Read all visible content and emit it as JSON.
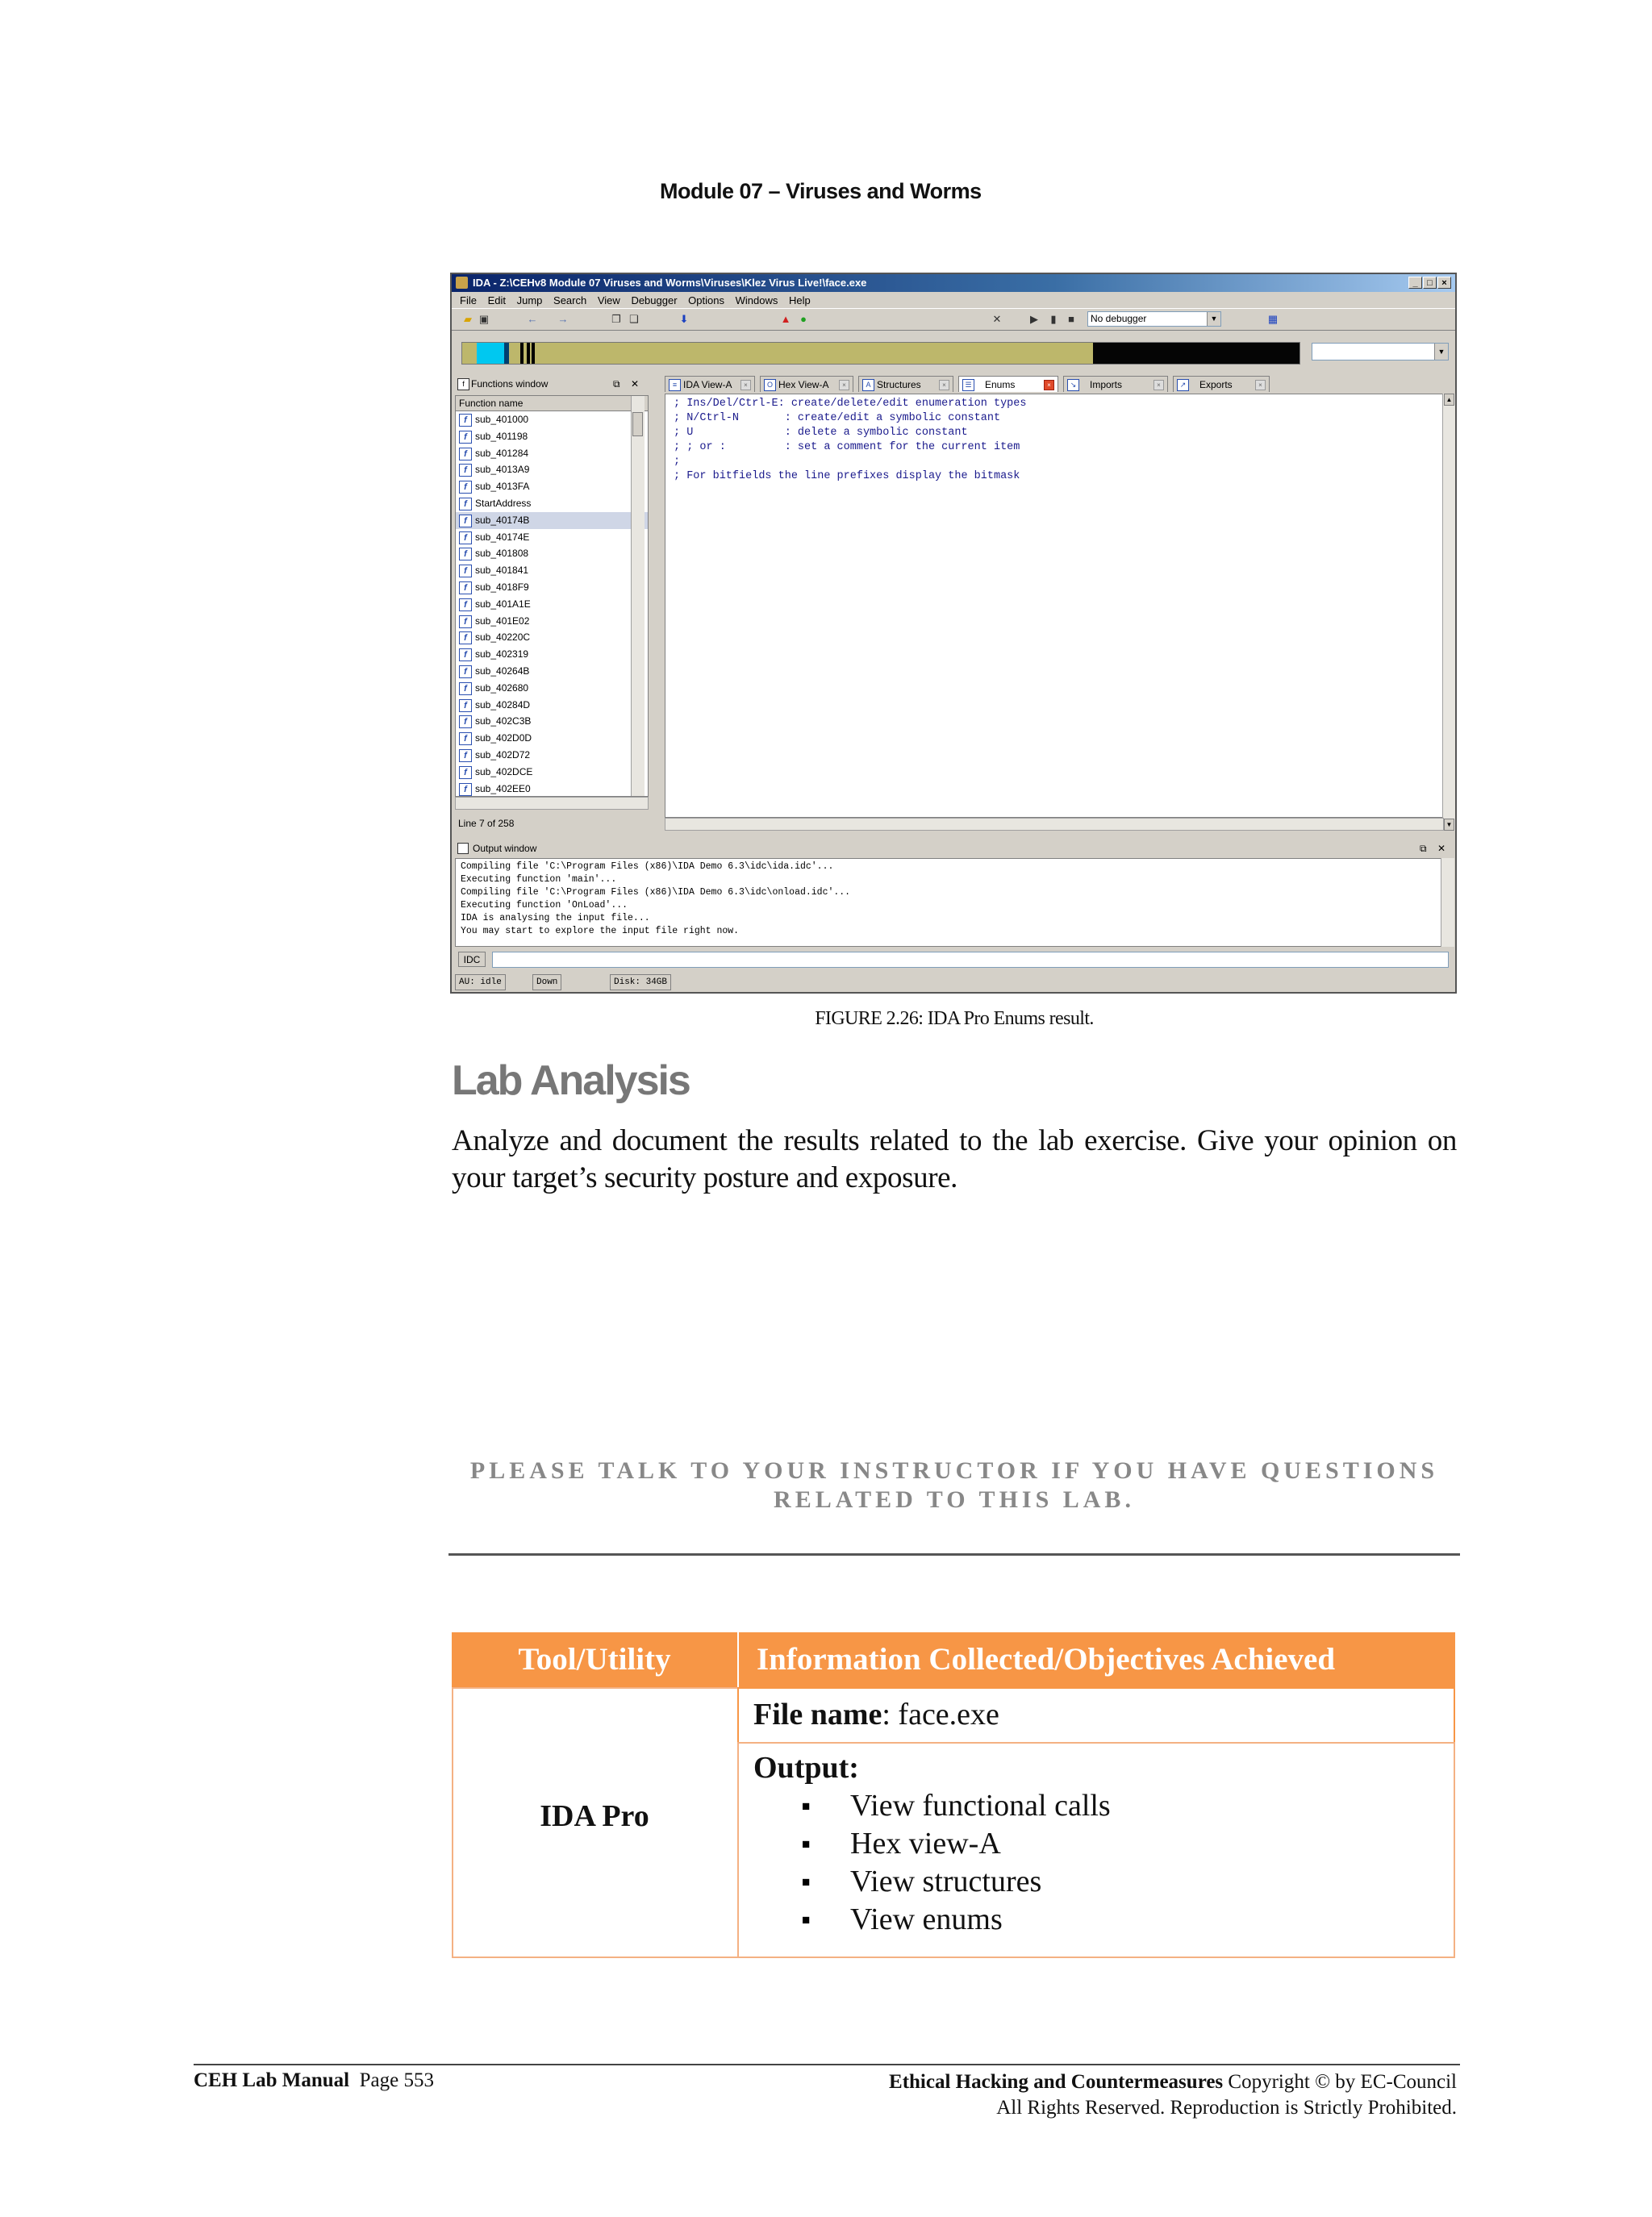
{
  "header": {
    "module_title": "Module 07 – Viruses and Worms"
  },
  "ida": {
    "title": "IDA - Z:\\CEHv8 Module 07 Viruses and Worms\\Viruses\\Klez Virus Live!\\face.exe",
    "menu": [
      "File",
      "Edit",
      "Jump",
      "Search",
      "View",
      "Debugger",
      "Options",
      "Windows",
      "Help"
    ],
    "debugger_select": "No debugger",
    "functions_pane": {
      "title": "Functions window",
      "column_header": "Function name",
      "functions": [
        "sub_401000",
        "sub_401198",
        "sub_401284",
        "sub_4013A9",
        "sub_4013FA",
        "StartAddress",
        "sub_40174B",
        "sub_40174E",
        "sub_401808",
        "sub_401841",
        "sub_4018F9",
        "sub_401A1E",
        "sub_401E02",
        "sub_40220C",
        "sub_402319",
        "sub_40264B",
        "sub_402680",
        "sub_40284D",
        "sub_402C3B",
        "sub_402D0D",
        "sub_402D72",
        "sub_402DCE",
        "sub_402EE0"
      ],
      "selected_index": 6,
      "status": "Line 7 of 258"
    },
    "tabs": [
      {
        "label": "IDA View-A",
        "icon": "ida-view-icon"
      },
      {
        "label": "Hex View-A",
        "icon": "hex-view-icon"
      },
      {
        "label": "Structures",
        "icon": "structures-icon"
      },
      {
        "label": "Enums",
        "icon": "enums-icon"
      },
      {
        "label": "Imports",
        "icon": "imports-icon"
      },
      {
        "label": "Exports",
        "icon": "exports-icon"
      }
    ],
    "active_tab": "Enums",
    "enums_lines": [
      "; Ins/Del/Ctrl-E: create/delete/edit enumeration types",
      "; N/Ctrl-N       : create/edit a symbolic constant",
      "; U              : delete a symbolic constant",
      "; ; or :         : set a comment for the current item",
      ";",
      "; For bitfields the line prefixes display the bitmask"
    ],
    "output_title": "Output window",
    "output_lines": [
      "Compiling file 'C:\\Program Files (x86)\\IDA Demo 6.3\\idc\\ida.idc'...",
      "Executing function 'main'...",
      "Compiling file 'C:\\Program Files (x86)\\IDA Demo 6.3\\idc\\onload.idc'...",
      "Executing function 'OnLoad'...",
      "IDA is analysing the input file...",
      "You may start to explore the input file right now."
    ],
    "idc_button": "IDC",
    "status": [
      "AU:  idle",
      "Down",
      "Disk: 34GB"
    ]
  },
  "caption": "FIGURE 2.26: IDA Pro Enums result.",
  "lab": {
    "heading": "Lab Analysis",
    "body": "Analyze and document the results related to the lab exercise. Give your opinion on your target’s security posture and exposure."
  },
  "notice": {
    "line1": "PLEASE TALK TO YOUR INSTRUCTOR IF YOU HAVE QUESTIONS",
    "line2": "RELATED TO THIS LAB."
  },
  "table": {
    "col1_header": "Tool/Utility",
    "col2_header": "Information Collected/Objectives Achieved",
    "tool": "IDA Pro",
    "file_label": "File name",
    "file_value": ": face.exe",
    "output_label": "Output:",
    "outputs": [
      "View functional calls",
      "Hex view-A",
      "View structures",
      "View enums"
    ]
  },
  "footer": {
    "manual": "CEH Lab Manual",
    "page": "Page 553",
    "right_bold": "Ethical Hacking and Countermeasures",
    "right_rest": " Copyright © by EC-Council",
    "rights": "All Rights Reserved. Reproduction is Strictly Prohibited."
  }
}
